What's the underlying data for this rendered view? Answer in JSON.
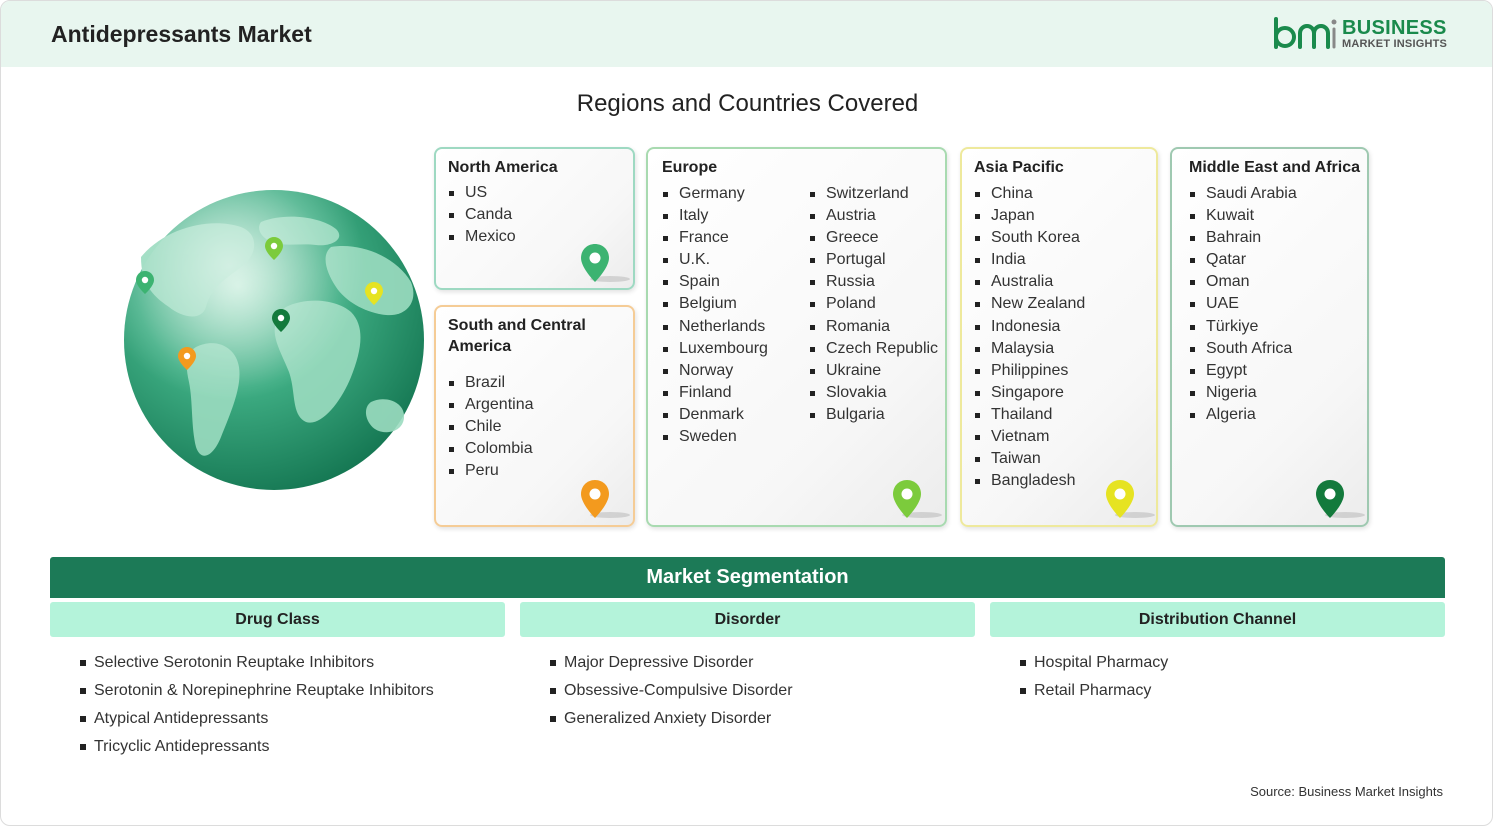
{
  "header": {
    "title": "Antidepressants Market"
  },
  "logo": {
    "line1": "BUSINESS",
    "line2": "MARKET INSIGHTS",
    "brand_color": "#1a8a4c"
  },
  "regions_title": "Regions and Countries Covered",
  "regions": {
    "north_america": {
      "title": "North America",
      "countries": [
        "US",
        "Canda",
        "Mexico"
      ],
      "pin_color": "#3cb371"
    },
    "south_central_america": {
      "title": "South and Central America",
      "countries": [
        "Brazil",
        "Argentina",
        "Chile",
        "Colombia",
        "Peru"
      ],
      "pin_color": "#f39a1e"
    },
    "europe": {
      "title": "Europe",
      "countries_col1": [
        "Germany",
        "Italy",
        "France",
        "U.K.",
        "Spain",
        "Belgium",
        "Netherlands",
        "Luxembourg",
        "Norway",
        "Finland",
        "Denmark",
        "Sweden"
      ],
      "countries_col2": [
        "Switzerland",
        "Austria",
        "Greece",
        "Portugal",
        "Russia",
        "Poland",
        "Romania",
        "Czech Republic",
        "Ukraine",
        "Slovakia",
        "Bulgaria"
      ],
      "pin_color": "#7ccb3c"
    },
    "asia_pacific": {
      "title": "Asia Pacific",
      "countries": [
        "China",
        "Japan",
        "South Korea",
        "India",
        "Australia",
        "New Zealand",
        "Indonesia",
        "Malaysia",
        "Philippines",
        "Singapore",
        "Thailand",
        "Vietnam",
        "Taiwan",
        "Bangladesh"
      ],
      "pin_color": "#e6e322"
    },
    "middle_east_africa": {
      "title": "Middle East and Africa",
      "countries": [
        "Saudi Arabia",
        "Kuwait",
        "Bahrain",
        "Qatar",
        "Oman",
        "UAE",
        "Türkiye",
        "South Africa",
        "Egypt",
        "Nigeria",
        "Algeria"
      ],
      "pin_color": "#137a3c"
    }
  },
  "segmentation": {
    "title": "Market Segmentation",
    "columns": [
      {
        "heading": "Drug Class",
        "items": [
          "Selective Serotonin Reuptake Inhibitors",
          "Serotonin & Norepinephrine Reuptake Inhibitors",
          "Atypical Antidepressants",
          "Tricyclic Antidepressants"
        ]
      },
      {
        "heading": "Disorder",
        "items": [
          "Major Depressive Disorder",
          "Obsessive-Compulsive Disorder",
          "Generalized Anxiety Disorder"
        ]
      },
      {
        "heading": "Distribution Channel",
        "items": [
          "Hospital Pharmacy",
          "Retail Pharmacy"
        ]
      }
    ]
  },
  "source": "Source: Business Market Insights"
}
